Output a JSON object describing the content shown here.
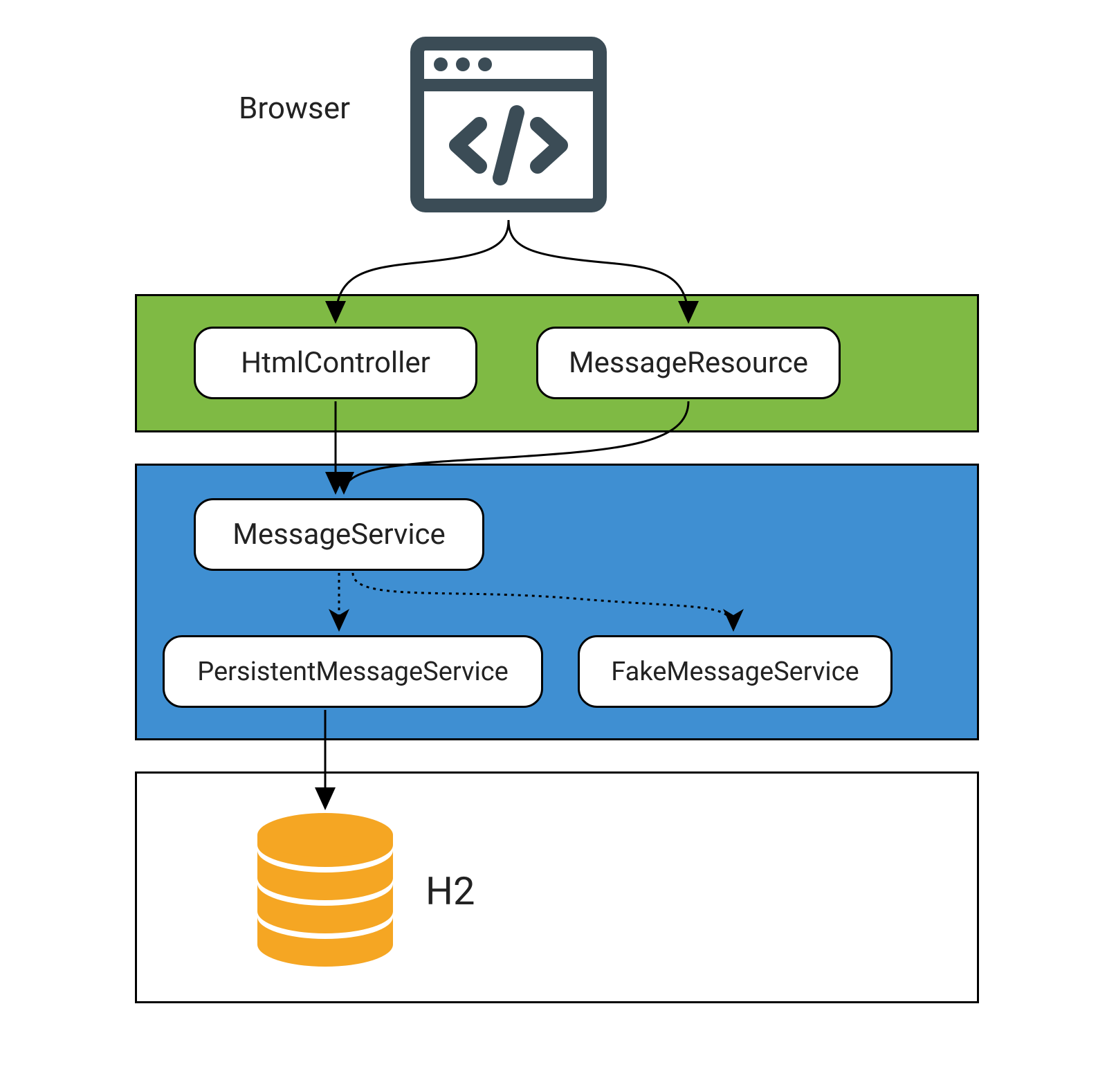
{
  "browser_label": "Browser",
  "layers": {
    "green": {
      "nodes": [
        "HtmlController",
        "MessageResource"
      ]
    },
    "blue": {
      "nodes": [
        "MessageService",
        "PersistentMessageService",
        "FakeMessageService"
      ]
    },
    "white": {
      "db_label": "H2"
    }
  },
  "colors": {
    "green": "#7FBA44",
    "blue": "#3F8FD2",
    "icon_stroke": "#3B4C56",
    "db_fill": "#F5A623"
  },
  "arrows": [
    {
      "from": "Browser",
      "to": "HtmlController",
      "style": "solid"
    },
    {
      "from": "Browser",
      "to": "MessageResource",
      "style": "solid"
    },
    {
      "from": "HtmlController",
      "to": "MessageService",
      "style": "solid"
    },
    {
      "from": "MessageResource",
      "to": "MessageService",
      "style": "solid"
    },
    {
      "from": "MessageService",
      "to": "PersistentMessageService",
      "style": "dotted"
    },
    {
      "from": "MessageService",
      "to": "FakeMessageService",
      "style": "dotted"
    },
    {
      "from": "PersistentMessageService",
      "to": "H2",
      "style": "solid"
    }
  ]
}
